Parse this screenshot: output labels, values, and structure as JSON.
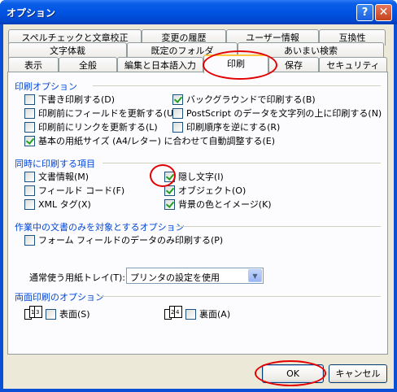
{
  "window": {
    "title": "オプション",
    "help_label": "?",
    "close_label": "✕"
  },
  "tabs": {
    "row1": [
      "スペルチェックと文章校正",
      "変更の履歴",
      "ユーザー情報",
      "互換性"
    ],
    "row2": [
      "文字体裁",
      "既定のフォルダ",
      "あいまい検索"
    ],
    "row3": [
      "表示",
      "全般",
      "編集と日本語入力",
      "印刷",
      "保存",
      "セキュリティ"
    ]
  },
  "print_options": {
    "title": "印刷オプション",
    "items": [
      {
        "label": "下書き印刷する(D)",
        "checked": false
      },
      {
        "label": "印刷前にフィールドを更新する(U)",
        "checked": false
      },
      {
        "label": "印刷前にリンクを更新する(L)",
        "checked": false
      },
      {
        "label": "基本の用紙サイズ (A4/レター) に合わせて自動調整する(E)",
        "checked": true
      },
      {
        "label": "バックグラウンドで印刷する(B)",
        "checked": true
      },
      {
        "label": "PostScript のデータを文字列の上に印刷する(N)",
        "checked": false
      },
      {
        "label": "印刷順序を逆にする(R)",
        "checked": false
      }
    ]
  },
  "include_items": {
    "title": "同時に印刷する項目",
    "items": [
      {
        "label": "文書情報(M)",
        "checked": false
      },
      {
        "label": "フィールド コード(F)",
        "checked": false
      },
      {
        "label": "XML タグ(X)",
        "checked": false
      },
      {
        "label": "隠し文字(I)",
        "checked": true
      },
      {
        "label": "オブジェクト(O)",
        "checked": true
      },
      {
        "label": "背景の色とイメージ(K)",
        "checked": true
      }
    ]
  },
  "current_doc": {
    "title": "作業中の文書のみを対象とするオプション",
    "items": [
      {
        "label": "フォーム フィールドのデータのみ印刷する(P)",
        "checked": false
      }
    ]
  },
  "tray": {
    "label": "通常使う用紙トレイ(T):",
    "value": "プリンタの設定を使用",
    "arrow": "▼"
  },
  "duplex": {
    "title": "両面印刷のオプション",
    "front_label": "表面(S)",
    "front_checked": false,
    "back_label": "裏面(A)",
    "back_checked": false,
    "front_icon": "duplex-front-icon",
    "back_icon": "duplex-back-icon"
  },
  "buttons": {
    "ok": "OK",
    "cancel": "キャンセル"
  },
  "colors": {
    "title_bar": "#0054e3",
    "group_title": "#0046d5",
    "highlight": "#e30000"
  }
}
